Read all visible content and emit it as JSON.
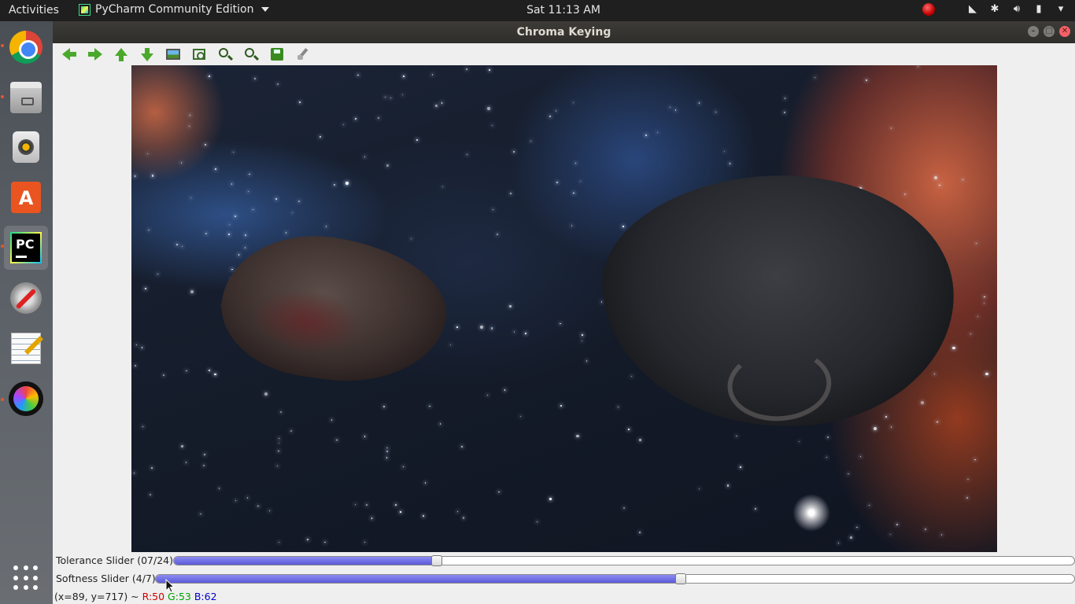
{
  "top_panel": {
    "activities": "Activities",
    "app_name": "PyCharm Community Edition",
    "clock": "Sat 11:13 AM",
    "icons": [
      "record-icon",
      "wifi-icon",
      "bluetooth-icon",
      "volume-icon",
      "battery-icon",
      "system-menu-icon"
    ]
  },
  "launcher": {
    "items": [
      "chrome",
      "files",
      "rhythmbox",
      "software-center",
      "pycharm",
      "settings",
      "text-editor",
      "camera-lens"
    ],
    "show_apps": "app-grid-icon"
  },
  "window": {
    "title": "Chroma Keying"
  },
  "toolbar": {
    "icons": [
      "back-arrow-icon",
      "forward-arrow-icon",
      "up-arrow-icon",
      "down-arrow-icon",
      "image-icon",
      "zoom-rect-icon",
      "zoom-in-icon",
      "zoom-out-icon",
      "save-icon",
      "brush-icon"
    ]
  },
  "sliders": {
    "tolerance": {
      "label": "Tolerance Slider (07/24)",
      "value": 7,
      "max": 24
    },
    "softness": {
      "label": "Softness Slider (4/7)",
      "value": 4,
      "max": 7
    }
  },
  "status": {
    "coords": "(x=89, y=717) ~",
    "r": "R:50",
    "g": "G:53",
    "b": "B:62"
  },
  "colors": {
    "slider_fill": "#6a69e0",
    "status_r": "#d00000",
    "status_g": "#00a000",
    "status_b": "#0000c8"
  }
}
